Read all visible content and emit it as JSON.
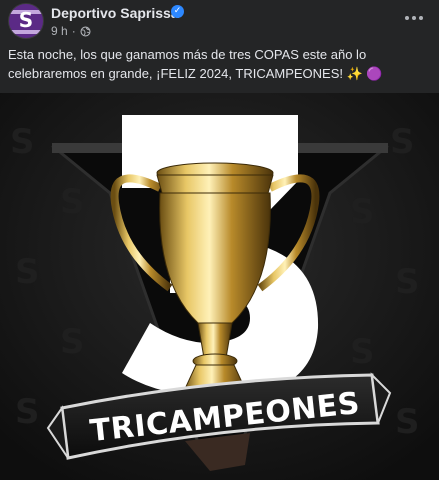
{
  "post": {
    "page_name": "Deportivo Saprissa",
    "avatar_letter": "S",
    "time": "9 h",
    "separator": "·",
    "text": "Esta noche, los que ganamos más de tres COPAS este año lo celebraremos en grande, ¡FELIZ 2024, TRICAMPEONES! ✨ 🟣",
    "more_icon": "ellipsis-icon",
    "privacy_icon": "globe-icon",
    "verified_icon": "verified-badge-icon"
  },
  "image": {
    "banner_text": "TRICAMPEONES",
    "big_number_color": "#ffffff",
    "trophy_color": "#c9a227"
  },
  "colors": {
    "background": "#242526",
    "text_primary": "#e4e6eb",
    "text_secondary": "#b0b3b8",
    "verified": "#2d88ff",
    "brand_purple": "#5b2a86"
  }
}
